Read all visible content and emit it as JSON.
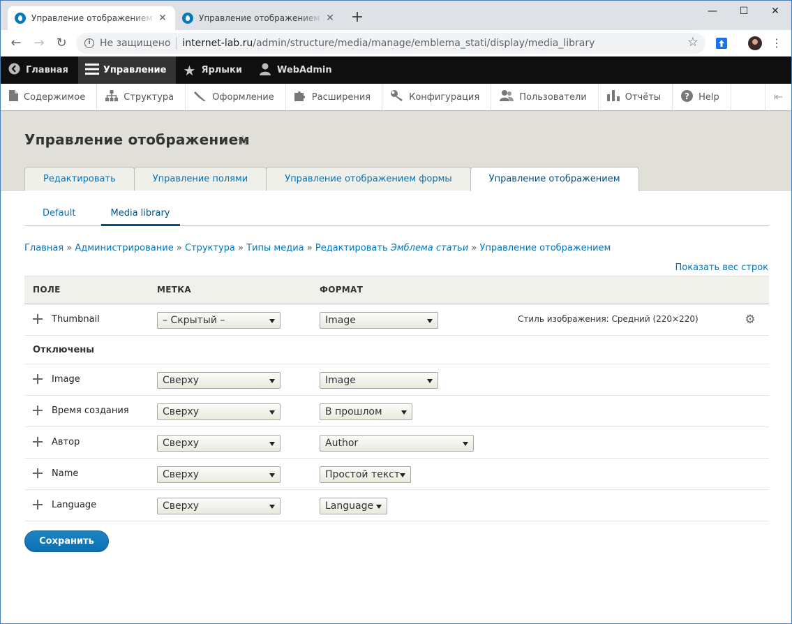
{
  "browser": {
    "tabs": [
      {
        "title": "Управление отображением | int",
        "active": true
      },
      {
        "title": "Управление отображением | int",
        "active": false
      }
    ],
    "security_label": "Не защищено",
    "url_host": "internet-lab.ru",
    "url_path": "/admin/structure/media/manage/emblema_stati/display/media_library"
  },
  "admin_toolbar": {
    "items": [
      {
        "label": "Главная",
        "icon": "back-icon"
      },
      {
        "label": "Управление",
        "icon": "menu-icon",
        "active": true
      },
      {
        "label": "Ярлыки",
        "icon": "star-icon"
      },
      {
        "label": "WebAdmin",
        "icon": "user-icon"
      }
    ]
  },
  "tray": {
    "items": [
      {
        "label": "Содержимое",
        "icon": "file-icon"
      },
      {
        "label": "Структура",
        "icon": "structure-icon"
      },
      {
        "label": "Оформление",
        "icon": "brush-icon"
      },
      {
        "label": "Расширения",
        "icon": "puzzle-icon"
      },
      {
        "label": "Конфигурация",
        "icon": "wrench-icon"
      },
      {
        "label": "Пользователи",
        "icon": "people-icon"
      },
      {
        "label": "Отчёты",
        "icon": "chart-icon"
      },
      {
        "label": "Help",
        "icon": "help-icon"
      }
    ]
  },
  "page": {
    "title": "Управление отображением",
    "primary_tabs": [
      {
        "label": "Редактировать"
      },
      {
        "label": "Управление полями"
      },
      {
        "label": "Управление отображением формы"
      },
      {
        "label": "Управление отображением",
        "active": true
      }
    ],
    "secondary_tabs": [
      {
        "label": "Default"
      },
      {
        "label": "Media library",
        "active": true
      }
    ],
    "breadcrumb": {
      "home": "Главная",
      "admin": "Администрирование",
      "structure": "Структура",
      "media_types": "Типы медиа",
      "edit_prefix": "Редактировать",
      "edit_name": "Эмблема статьи",
      "current": "Управление отображением",
      "sep": "»"
    },
    "show_weights": "Показать вес строк"
  },
  "table": {
    "headers": {
      "field": "ПОЛЕ",
      "label": "МЕТКА",
      "format": "ФОРМАТ"
    },
    "enabled": [
      {
        "field": "Thumbnail",
        "label": "– Скрытый –",
        "format": "Image",
        "summary": "Стиль изображения: Средний (220×220)"
      }
    ],
    "disabled_region": "Отключены",
    "disabled": [
      {
        "field": "Image",
        "label": "Сверху",
        "format": "Image"
      },
      {
        "field": "Время создания",
        "label": "Сверху",
        "format": "В прошлом"
      },
      {
        "field": "Автор",
        "label": "Сверху",
        "format": "Author"
      },
      {
        "field": "Name",
        "label": "Сверху",
        "format": "Простой текст"
      },
      {
        "field": "Language",
        "label": "Сверху",
        "format": "Language"
      }
    ]
  },
  "save_button": "Сохранить",
  "colors": {
    "link": "#0074bd",
    "primary_button": "#1b7fc0",
    "toolbar": "#0f0f0f"
  }
}
